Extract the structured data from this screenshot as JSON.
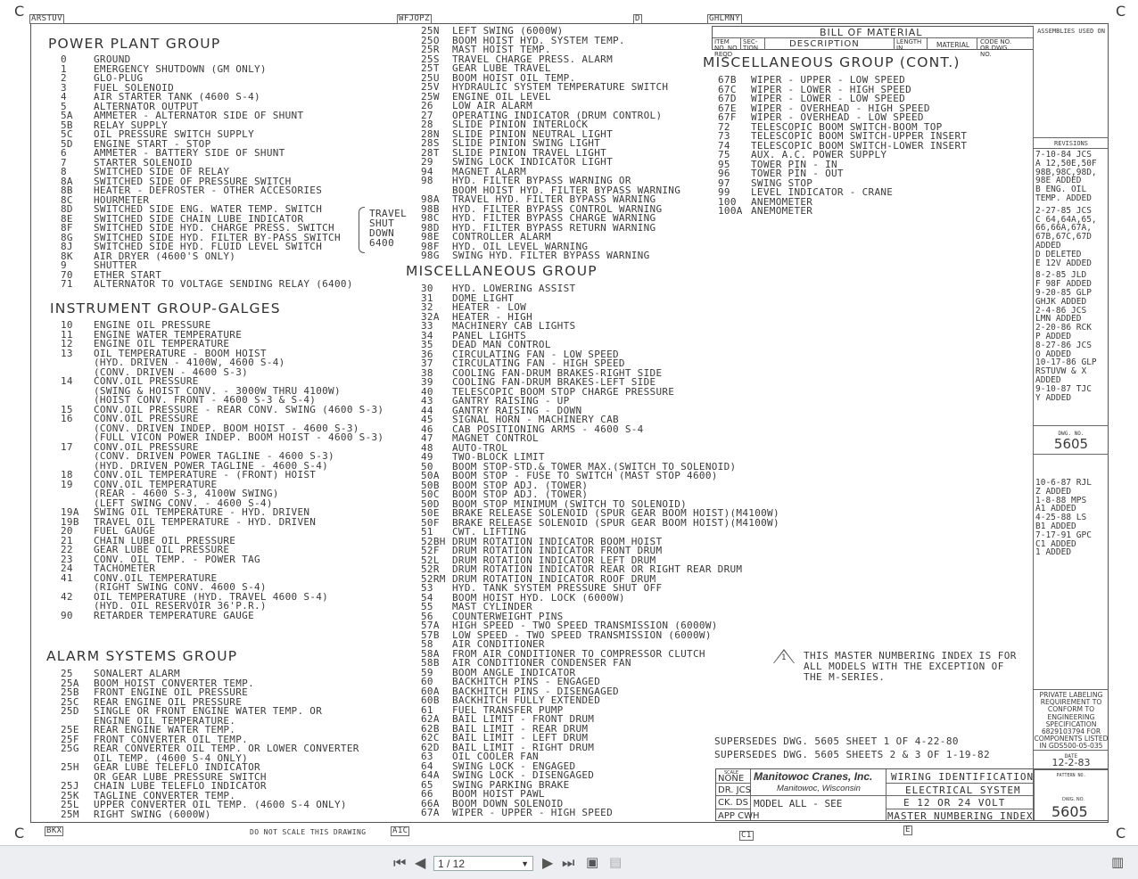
{
  "zone_markers": {
    "top_left": "ARSTUV",
    "top_mid": "WFJOPZ",
    "top_d": "D",
    "top_right": "GHLMNY",
    "bottom_left": "BKX",
    "bottom_mid": "A1C",
    "bottom_c": "C1",
    "bottom_e": "E",
    "corner": "C"
  },
  "power_plant": {
    "title": "POWER PLANT GROUP",
    "items": [
      [
        "0",
        "GROUND"
      ],
      [
        "1",
        "EMERGENCY SHUTDOWN (GM ONLY)"
      ],
      [
        "2",
        "GLO-PLUG"
      ],
      [
        "3",
        "FUEL SOLENOID"
      ],
      [
        "4",
        "AIR STARTER TANK (4600 S-4)"
      ],
      [
        "5",
        "ALTERNATOR OUTPUT"
      ],
      [
        "5A",
        "AMMETER - ALTERNATOR SIDE OF SHUNT"
      ],
      [
        "5B",
        "RELAY SUPPLY"
      ],
      [
        "5C",
        "OIL PRESSURE SWITCH SUPPLY"
      ],
      [
        "5D",
        "ENGINE START - STOP"
      ],
      [
        "6",
        "AMMETER - BATTERY SIDE OF SHUNT"
      ],
      [
        "7",
        "STARTER SOLENOID"
      ],
      [
        "8",
        "SWITCHED SIDE OF RELAY"
      ],
      [
        "8A",
        "SWITCHED SIDE OF PRESSURE SWITCH"
      ],
      [
        "8B",
        "HEATER - DEFROSTER - OTHER ACCESORIES"
      ],
      [
        "8C",
        "HOURMETER"
      ],
      [
        "8D",
        "SWITCHED SIDE ENG. WATER TEMP. SWITCH"
      ],
      [
        "8E",
        "SWITCHED SIDE CHAIN LUBE INDICATOR"
      ],
      [
        "8F",
        "SWITCHED SIDE HYD. CHARGE PRESS. SWITCH"
      ],
      [
        "8G",
        "SWITCHED SIDE HYD. FILTER BY-PASS SWITCH"
      ],
      [
        "8J",
        "SWITCHED SIDE HYD. FLUID LEVEL SWITCH"
      ],
      [
        "8K",
        "AIR DRYER (4600'S ONLY)"
      ],
      [
        "9",
        "SHUTTER"
      ],
      [
        "70",
        "ETHER START"
      ],
      [
        "71",
        "ALTERNATOR TO VOLTAGE SENDING RELAY (6400)"
      ]
    ],
    "travel_note": [
      "TRAVEL",
      "SHUT",
      "DOWN",
      "6400"
    ]
  },
  "instrument": {
    "title": "INSTRUMENT GROUP-GALGES",
    "items": [
      [
        "10",
        "ENGINE OIL PRESSURE"
      ],
      [
        "11",
        "ENGINE WATER TEMPERATURE"
      ],
      [
        "12",
        "ENGINE OIL TEMPERATURE"
      ],
      [
        "13",
        "OIL TEMPERATURE - BOOM HOIST"
      ],
      [
        "",
        "(HYD. DRIVEN - 4100W, 4600 S-4)"
      ],
      [
        "",
        "(CONV. DRIVEN - 4600 S-3)"
      ],
      [
        "14",
        "CONV.OIL PRESSURE"
      ],
      [
        "",
        "(SWING & HOIST CONV. - 3000W THRU 4100W)"
      ],
      [
        "",
        "(HOIST CONV. FRONT - 4600 S-3 & S-4)"
      ],
      [
        "15",
        "CONV.OIL PRESSURE - REAR CONV. SWING (4600 S-3)"
      ],
      [
        "16",
        "CONV.OIL PRESSURE"
      ],
      [
        "",
        "(CONV. DRIVEN INDEP. BOOM HOIST - 4600 S-3)"
      ],
      [
        "",
        "(FULL VICON POWER INDEP. BOOM HOIST - 4600 S-3)"
      ],
      [
        "17",
        "CONV.OIL PRESSURE"
      ],
      [
        "",
        "(CONV. DRIVEN POWER TAGLINE - 4600 S-3)"
      ],
      [
        "",
        "(HYD. DRIVEN POWER TAGLINE - 4600 S-4)"
      ],
      [
        "18",
        "CONV.OIL TEMPERATURE - (FRONT) HOIST"
      ],
      [
        "19",
        "CONV.OIL TEMPERATURE"
      ],
      [
        "",
        "(REAR - 4600 S-3, 4100W SWING)"
      ],
      [
        "",
        "(LEFT SWING CONV. - 4600 S-4)"
      ],
      [
        "19A",
        "SWING OIL TEMPERATURE - HYD. DRIVEN"
      ],
      [
        "19B",
        "TRAVEL OIL TEMPERATURE - HYD. DRIVEN"
      ],
      [
        "20",
        "FUEL GAUGE"
      ],
      [
        "21",
        "CHAIN LUBE OIL PRESSURE"
      ],
      [
        "22",
        "GEAR LUBE OIL PRESSURE"
      ],
      [
        "23",
        "CONV. OIL TEMP. - POWER TAG"
      ],
      [
        "24",
        "TACHOMETER"
      ],
      [
        "41",
        "CONV.OIL TEMPERATURE"
      ],
      [
        "",
        "(RIGHT SWING CONV. 4600 S-4)"
      ],
      [
        "42",
        "OIL TEMPERATURE (HYD. TRAVEL 4600 S-4)"
      ],
      [
        "",
        "(HYD. OIL RESERVOIR 36'P.R.)"
      ],
      [
        "90",
        "RETARDER TEMPERATURE GAUGE"
      ]
    ]
  },
  "alarm": {
    "title": "ALARM SYSTEMS GROUP",
    "items": [
      [
        "25",
        "SONALERT ALARM"
      ],
      [
        "25A",
        "BOOM HOIST CONVERTER TEMP."
      ],
      [
        "25B",
        "FRONT ENGINE OIL PRESSURE"
      ],
      [
        "25C",
        "REAR ENGINE OIL PRESSURE"
      ],
      [
        "25D",
        "SINGLE OR FRONT ENGINE WATER TEMP. OR"
      ],
      [
        "",
        "ENGINE OIL TEMPERATURE."
      ],
      [
        "25E",
        "REAR ENGINE WATER TEMP."
      ],
      [
        "25F",
        "FRONT CONVERTER OIL TEMP."
      ],
      [
        "25G",
        "REAR CONVERTER OIL TEMP. OR LOWER CONVERTER"
      ],
      [
        "",
        "OIL TEMP. (4600 S-4 ONLY)"
      ],
      [
        "25H",
        "GEAR LUBE TELEFLO INDICATOR"
      ],
      [
        "",
        "OR GEAR LUBE PRESSURE SWITCH"
      ],
      [
        "25J",
        "CHAIN LUBE TELEFLO INDICATOR"
      ],
      [
        "25K",
        "TAGLINE CONVERTER TEMP."
      ],
      [
        "25L",
        "UPPER CONVERTER OIL TEMP. (4600 S-4 ONLY)"
      ],
      [
        "25M",
        "RIGHT SWING (6000W)"
      ]
    ]
  },
  "alarm_cont": {
    "items": [
      [
        "25N",
        "LEFT SWING (6000W)"
      ],
      [
        "25O",
        "BOOM HOIST HYD. SYSTEM TEMP."
      ],
      [
        "25R",
        "MAST HOIST TEMP."
      ],
      [
        "25S",
        "TRAVEL CHARGE PRESS. ALARM"
      ],
      [
        "25T",
        "GEAR LUBE TRAVEL"
      ],
      [
        "25U",
        "BOOM HOIST OIL TEMP."
      ],
      [
        "25V",
        "HYDRAULIC SYSTEM TEMPERATURE SWITCH"
      ],
      [
        "25W",
        "ENGINE OIL LEVEL"
      ],
      [
        "26",
        "LOW AIR ALARM"
      ],
      [
        "27",
        "OPERATING INDICATOR (DRUM CONTROL)"
      ],
      [
        "28",
        "SLIDE PINION INTERLOCK"
      ],
      [
        "28N",
        "SLIDE PINION NEUTRAL LIGHT"
      ],
      [
        "28S",
        "SLIDE PINION SWING LIGHT"
      ],
      [
        "28T",
        "SLIDE PINION TRAVEL LIGHT"
      ],
      [
        "29",
        "SWING LOCK INDICATOR LIGHT"
      ],
      [
        "94",
        "MAGNET ALARM"
      ],
      [
        "98",
        "HYD. FILTER BYPASS WARNING OR"
      ],
      [
        "",
        "BOOM HOIST HYD. FILTER BYPASS WARNING"
      ],
      [
        "98A",
        "TRAVEL HYD. FILTER BYPASS WARNING"
      ],
      [
        "98B",
        "HYD. FILTER BYPASS CONTROL WARNING"
      ],
      [
        "98C",
        "HYD. FILTER BYPASS CHARGE WARNING"
      ],
      [
        "98D",
        "HYD. FILTER BYPASS RETURN WARNING"
      ],
      [
        "98E",
        "CONTROLLER ALARM"
      ],
      [
        "98F",
        "HYD. OIL LEVEL WARNING"
      ],
      [
        "98G",
        "SWING HYD. FILTER BYPASS WARNING"
      ]
    ]
  },
  "misc": {
    "title": "MISCELLANEOUS GROUP",
    "items": [
      [
        "30",
        "HYD. LOWERING ASSIST"
      ],
      [
        "31",
        "DOME LIGHT"
      ],
      [
        "32",
        "HEATER - LOW"
      ],
      [
        "32A",
        "HEATER - HIGH"
      ],
      [
        "33",
        "MACHINERY CAB LIGHTS"
      ],
      [
        "34",
        "PANEL LIGHTS"
      ],
      [
        "35",
        "DEAD MAN CONTROL"
      ],
      [
        "36",
        "CIRCULATING FAN - LOW SPEED"
      ],
      [
        "37",
        "CIRCULATING FAN - HIGH SPEED"
      ],
      [
        "38",
        "COOLING FAN-DRUM BRAKES-RIGHT SIDE"
      ],
      [
        "39",
        "COOLING FAN-DRUM BRAKES-LEFT SIDE"
      ],
      [
        "40",
        "TELESCOPIC BOOM STOP CHARGE PRESSURE"
      ],
      [
        "43",
        "GANTRY RAISING - UP"
      ],
      [
        "44",
        "GANTRY RAISING - DOWN"
      ],
      [
        "45",
        "SIGNAL HORN - MACHINERY CAB"
      ],
      [
        "46",
        "CAB POSITIONING ARMS - 4600 S-4"
      ],
      [
        "47",
        "MAGNET CONTROL"
      ],
      [
        "48",
        "AUTO-TROL"
      ],
      [
        "49",
        "TWO-BLOCK LIMIT"
      ],
      [
        "50",
        "BOOM STOP-STD.& TOWER MAX.(SWITCH TO SOLENOID)"
      ],
      [
        "50A",
        "BOOM STOP - FUSE TO SWITCH (MAST STOP 4600)"
      ],
      [
        "50B",
        "BOOM STOP ADJ. (TOWER)"
      ],
      [
        "50C",
        "BOOM STOP ADJ. (TOWER)"
      ],
      [
        "50D",
        "BOOM STOP MINIMUM (SWITCH TO SOLENOID)"
      ],
      [
        "50E",
        "BRAKE RELEASE SOLENOID (SPUR GEAR BOOM HOIST)(M4100W)"
      ],
      [
        "50F",
        "BRAKE RELEASE SOLENOID (SPUR GEAR BOOM HOIST)(M4100W)"
      ],
      [
        "51",
        "CWT. LIFTING"
      ],
      [
        "52BH",
        "DRUM ROTATION INDICATOR BOOM HOIST"
      ],
      [
        "52F",
        "DRUM ROTATION INDICATOR FRONT DRUM"
      ],
      [
        "52L",
        "DRUM ROTATION INDICATOR LEFT DRUM"
      ],
      [
        "52R",
        "DRUM ROTATION INDICATOR REAR OR RIGHT REAR DRUM"
      ],
      [
        "52RM",
        "DRUM ROTATION INDICATOR ROOF DRUM"
      ],
      [
        "53",
        "HYD. TANK SYSTEM PRESSURE SHUT OFF"
      ],
      [
        "54",
        "BOOM HOIST HYD. LOCK (6000W)"
      ],
      [
        "55",
        "MAST CYLINDER"
      ],
      [
        "56",
        "COUNTERWEIGHT PINS"
      ],
      [
        "57A",
        "HIGH SPEED - TWO SPEED TRANSMISSION (6000W)"
      ],
      [
        "57B",
        "LOW SPEED - TWO SPEED TRANSMISSION (6000W)"
      ],
      [
        "58",
        "AIR CONDITIONER"
      ],
      [
        "58A",
        "FROM AIR CONDITIONER TO COMPRESSOR CLUTCH"
      ],
      [
        "58B",
        "AIR CONDITIONER CONDENSER FAN"
      ],
      [
        "59",
        "BOOM ANGLE INDICATOR"
      ],
      [
        "60",
        "BACKHITCH PINS - ENGAGED"
      ],
      [
        "60A",
        "BACKHITCH PINS - DISENGAGED"
      ],
      [
        "60B",
        "BACKHITCH FULLY EXTENDED"
      ],
      [
        "61",
        "FUEL TRANSFER PUMP"
      ],
      [
        "62A",
        "BAIL LIMIT - FRONT DRUM"
      ],
      [
        "62B",
        "BAIL LIMIT - REAR DRUM"
      ],
      [
        "62C",
        "BAIL LIMIT - LEFT DRUM"
      ],
      [
        "62D",
        "BAIL LIMIT - RIGHT DRUM"
      ],
      [
        "63",
        "OIL COOLER FAN"
      ],
      [
        "64",
        "SWING LOCK - ENGAGED"
      ],
      [
        "64A",
        "SWING LOCK - DISENGAGED"
      ],
      [
        "65",
        "SWING PARKING BRAKE"
      ],
      [
        "66",
        "BOOM HOIST PAWL"
      ],
      [
        "66A",
        "BOOM DOWN SOLENOID"
      ],
      [
        "67A",
        "WIPER - UPPER - HIGH SPEED"
      ]
    ]
  },
  "misc_cont": {
    "title": "MISCELLANEOUS GROUP (CONT.)",
    "items": [
      [
        "67B",
        "WIPER - UPPER - LOW SPEED"
      ],
      [
        "67C",
        "WIPER - LOWER - HIGH SPEED"
      ],
      [
        "67D",
        "WIPER - LOWER - LOW SPEED"
      ],
      [
        "67E",
        "WIPER - OVERHEAD - HIGH SPEED"
      ],
      [
        "67F",
        "WIPER - OVERHEAD - LOW SPEED"
      ],
      [
        "72",
        "TELESCOPIC BOOM SWITCH-BOOM TOP"
      ],
      [
        "73",
        "TELESCOPIC BOOM SWITCH-UPPER INSERT"
      ],
      [
        "74",
        "TELESCOPIC BOOM SWITCH-LOWER INSERT"
      ],
      [
        "75",
        "AUX. A.C. POWER SUPPLY"
      ],
      [
        "95",
        "TOWER PIN - IN"
      ],
      [
        "96",
        "TOWER PIN - OUT"
      ],
      [
        "97",
        "SWING STOP"
      ],
      [
        "99",
        "LEVEL INDICATOR - CRANE"
      ],
      [
        "100",
        "ANEMOMETER"
      ],
      [
        "100A",
        "ANEMOMETER"
      ]
    ]
  },
  "bom": {
    "title": "BILL OF MATERIAL",
    "cols": [
      "ITEM NO. NO. REQD",
      "SEC- TION",
      "DESCRIPTION",
      "LENGTH IN.",
      "MATERIAL",
      "CODE NO. OR DWG. NO."
    ]
  },
  "side": {
    "assemblies": "ASSEMBLIES USED ON",
    "revisions": "REVISIONS",
    "rev_lines": [
      "7-10-84 JCS",
      "A 12,50E,50F",
      "98B,98C,98D,",
      "98E ADDED",
      "B ENG. OIL",
      "TEMP. ADDED",
      "",
      "2-27-85 JCS",
      "C 64,64A,65,",
      "66,66A,67A,",
      "67B,67C,67D",
      "ADDED",
      "D DELETED",
      "E 12V ADDED",
      "",
      "8-2-85 JLD",
      "F 98F ADDED",
      "9-20-85 GLP",
      "GHJK ADDED",
      "2-4-86 JCS",
      "LMN ADDED",
      "2-20-86 RCK",
      "P ADDED",
      "8-27-86 JCS",
      "O ADDED",
      "10-17-86 GLP",
      "RSTUVW & X",
      "ADDED",
      "9-10-87 TJC",
      "Y ADDED"
    ],
    "dwg_no_label": "DWG. NO.",
    "dwg_no": "5605",
    "rev_lines2": [
      "10-6-87 RJL",
      "Z ADDED",
      "1-8-88 MPS",
      "A1 ADDED",
      "4-25-88 LS",
      "B1 ADDED",
      "7-17-91 GPC",
      "C1 ADDED",
      "1 ADDED"
    ],
    "private": "PRIVATE LABELING REQUIREMENT TO CONFORM TO ENGINEERING SPECIFICATION 6829103794 FOR COMPONENTS LISTED IN GDS500-05-035",
    "date_label": "DATE",
    "date": "12-2-83",
    "pattern": "PATTERN NO."
  },
  "note": {
    "num": "1",
    "text": [
      "THIS MASTER NUMBERING INDEX IS FOR",
      "ALL MODELS WITH THE EXCEPTION OF",
      "THE M-SERIES."
    ]
  },
  "supersedes": [
    "SUPERSEDES DWG. 5605 SHEET 1 OF 4-22-80",
    "SUPERSEDES DWG. 5605 SHEETS 2 & 3 OF 1-19-82"
  ],
  "title_block": {
    "scale_label": "SCALE",
    "scale": "NONE",
    "dr": "DR. JCS",
    "ck": "CK. DS",
    "app": "APP CWH",
    "company": "Manitowoc Cranes, Inc.",
    "city": "Manitowoc, Wisconsin",
    "model": "MODEL ALL - SEE",
    "t1": "WIRING IDENTIFICATION",
    "t2": "ELECTRICAL SYSTEM",
    "t3": "E 12 OR 24 VOLT",
    "t4": "MASTER NUMBERING INDEX",
    "dwg_label": "DWG. NO.",
    "dwg": "5605"
  },
  "footer_note": "DO NOT SCALE THIS DRAWING",
  "toolbar": {
    "page": "1 / 12"
  }
}
